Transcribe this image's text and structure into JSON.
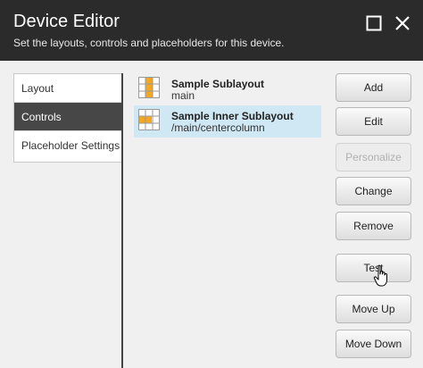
{
  "header": {
    "title": "Device Editor",
    "subtitle": "Set the layouts, controls and placeholders for this device.",
    "maximize_icon": "maximize-icon",
    "close_icon": "close-icon"
  },
  "tabs": [
    {
      "label": "Layout",
      "active": false
    },
    {
      "label": "Controls",
      "active": true
    },
    {
      "label": "Placeholder Settings",
      "active": false
    }
  ],
  "items": [
    {
      "title": "Sample Sublayout",
      "path": "main",
      "selected": false,
      "icon": "sublayout-grid-icon"
    },
    {
      "title": "Sample Inner Sublayout",
      "path": "/main/centercolumn",
      "selected": true,
      "icon": "sublayout-grid-icon"
    }
  ],
  "buttons": {
    "add": "Add",
    "edit": "Edit",
    "personalize": "Personalize",
    "change": "Change",
    "remove": "Remove",
    "test": "Test",
    "move_up": "Move Up",
    "move_down": "Move Down"
  },
  "colors": {
    "header_bg": "#2b2b2b",
    "active_tab_bg": "#474747",
    "selected_item_bg": "#cfe8f3",
    "icon_orange": "#f5a623"
  }
}
